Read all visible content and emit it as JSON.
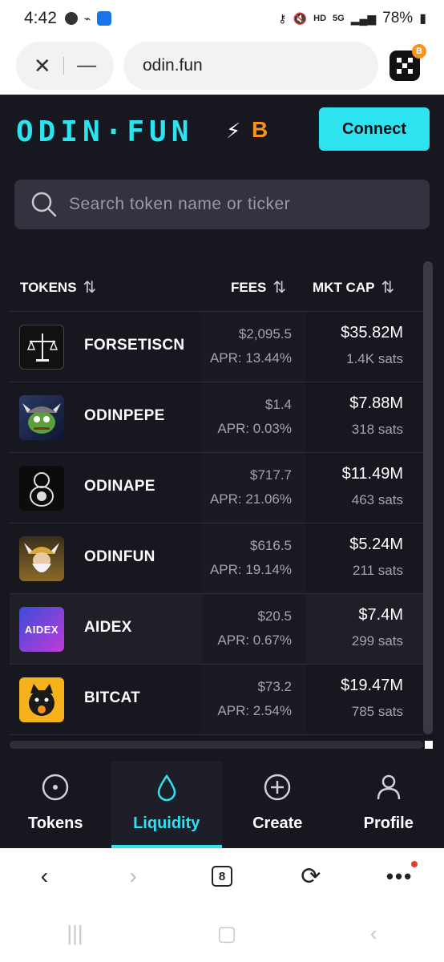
{
  "status_bar": {
    "time": "4:42",
    "network": "HD",
    "signal_label": "5G",
    "battery": "78%"
  },
  "browser": {
    "url": "odin.fun",
    "tab_count": "8",
    "extension_badge": "B"
  },
  "app": {
    "logo_text": "ODIN·FUN",
    "logo_suffix": "B",
    "connect_label": "Connect",
    "search_placeholder": "Search token name or ticker",
    "columns": {
      "tokens": "TOKENS",
      "fees": "FEES",
      "mkt_cap": "MKT CAP"
    },
    "rows": [
      {
        "name": "FORSETISCN",
        "fee": "$2,095.5",
        "apr": "APR: 13.44%",
        "mkt_cap": "$35.82M",
        "price": "1.4K sats"
      },
      {
        "name": "ODINPEPE",
        "fee": "$1.4",
        "apr": "APR: 0.03%",
        "mkt_cap": "$7.88M",
        "price": "318 sats"
      },
      {
        "name": "ODINAPE",
        "fee": "$717.7",
        "apr": "APR: 21.06%",
        "mkt_cap": "$11.49M",
        "price": "463 sats"
      },
      {
        "name": "ODINFUN",
        "fee": "$616.5",
        "apr": "APR: 19.14%",
        "mkt_cap": "$5.24M",
        "price": "211 sats"
      },
      {
        "name": "AIDEX",
        "fee": "$20.5",
        "apr": "APR: 0.67%",
        "mkt_cap": "$7.4M",
        "price": "299 sats",
        "avatar_text": "AIDEX"
      },
      {
        "name": "BITCAT",
        "fee": "$73.2",
        "apr": "APR: 2.54%",
        "mkt_cap": "$19.47M",
        "price": "785 sats"
      }
    ],
    "bottom_nav": [
      {
        "label": "Tokens",
        "icon": "circle-dot-icon"
      },
      {
        "label": "Liquidity",
        "icon": "droplet-icon",
        "active": true
      },
      {
        "label": "Create",
        "icon": "plus-circle-icon"
      },
      {
        "label": "Profile",
        "icon": "user-icon"
      }
    ]
  },
  "colors": {
    "accent": "#2de3f0",
    "background": "#17171f",
    "bitcoin": "#f7931a"
  }
}
